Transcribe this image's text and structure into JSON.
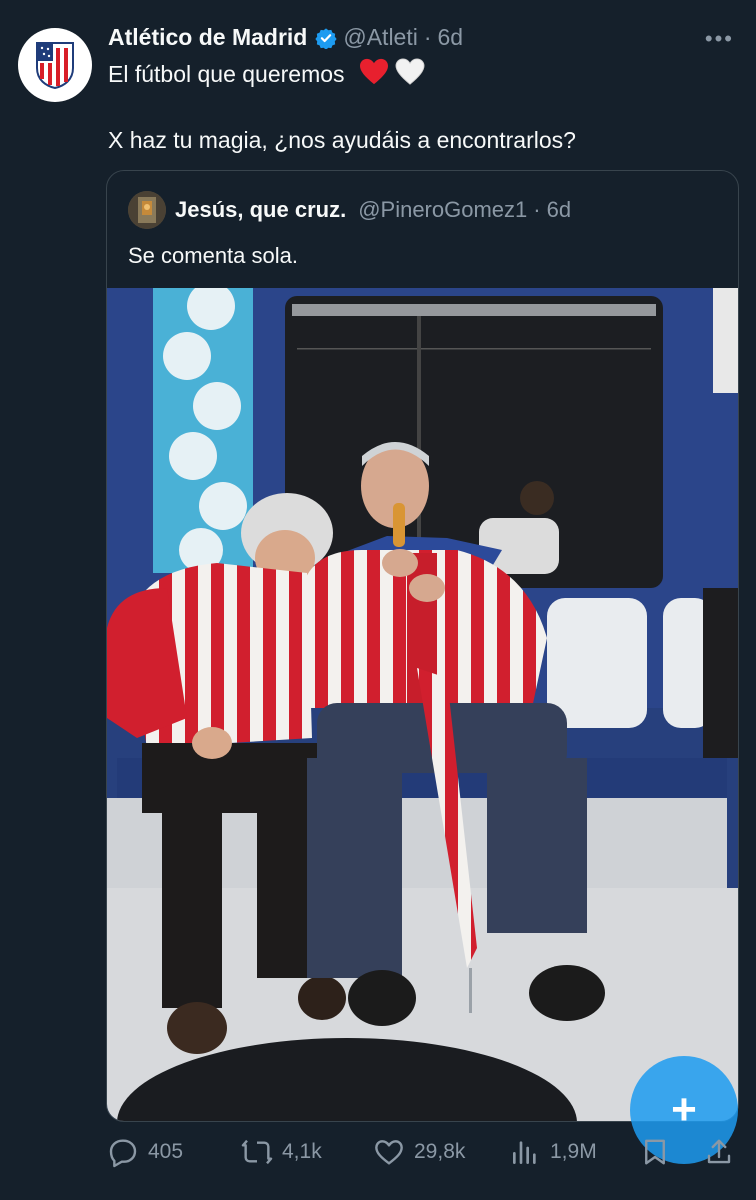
{
  "tweet": {
    "author_name": "Atlético de Madrid",
    "handle": "@Atleti",
    "separator": "·",
    "time": "6d",
    "text": "El fútbol que queremos",
    "emoji_1": "red-heart",
    "emoji_2": "white-heart",
    "text_line2": "X haz tu magia, ¿nos ayudáis a encontrarlos?"
  },
  "quoted": {
    "author_name": "Jesús, que cruz.",
    "handle": "@PineroGomez1",
    "separator": "·",
    "time": "6d",
    "text": "Se comenta sola."
  },
  "actions": {
    "replies": "405",
    "reposts": "4,1k",
    "likes": "29,8k",
    "views": "1,9M"
  },
  "fab": {
    "label": "+"
  },
  "colors": {
    "background": "#15202b",
    "text": "#f7f9f9",
    "muted": "#8b98a5",
    "accent": "#1d9bf0",
    "border": "#38444d",
    "atleti_red": "#d81e28"
  },
  "icons": [
    "more-icon",
    "verified-badge-icon",
    "reply-icon",
    "repost-icon",
    "like-icon",
    "views-icon",
    "bookmark-icon",
    "share-icon",
    "compose-plus-icon"
  ]
}
